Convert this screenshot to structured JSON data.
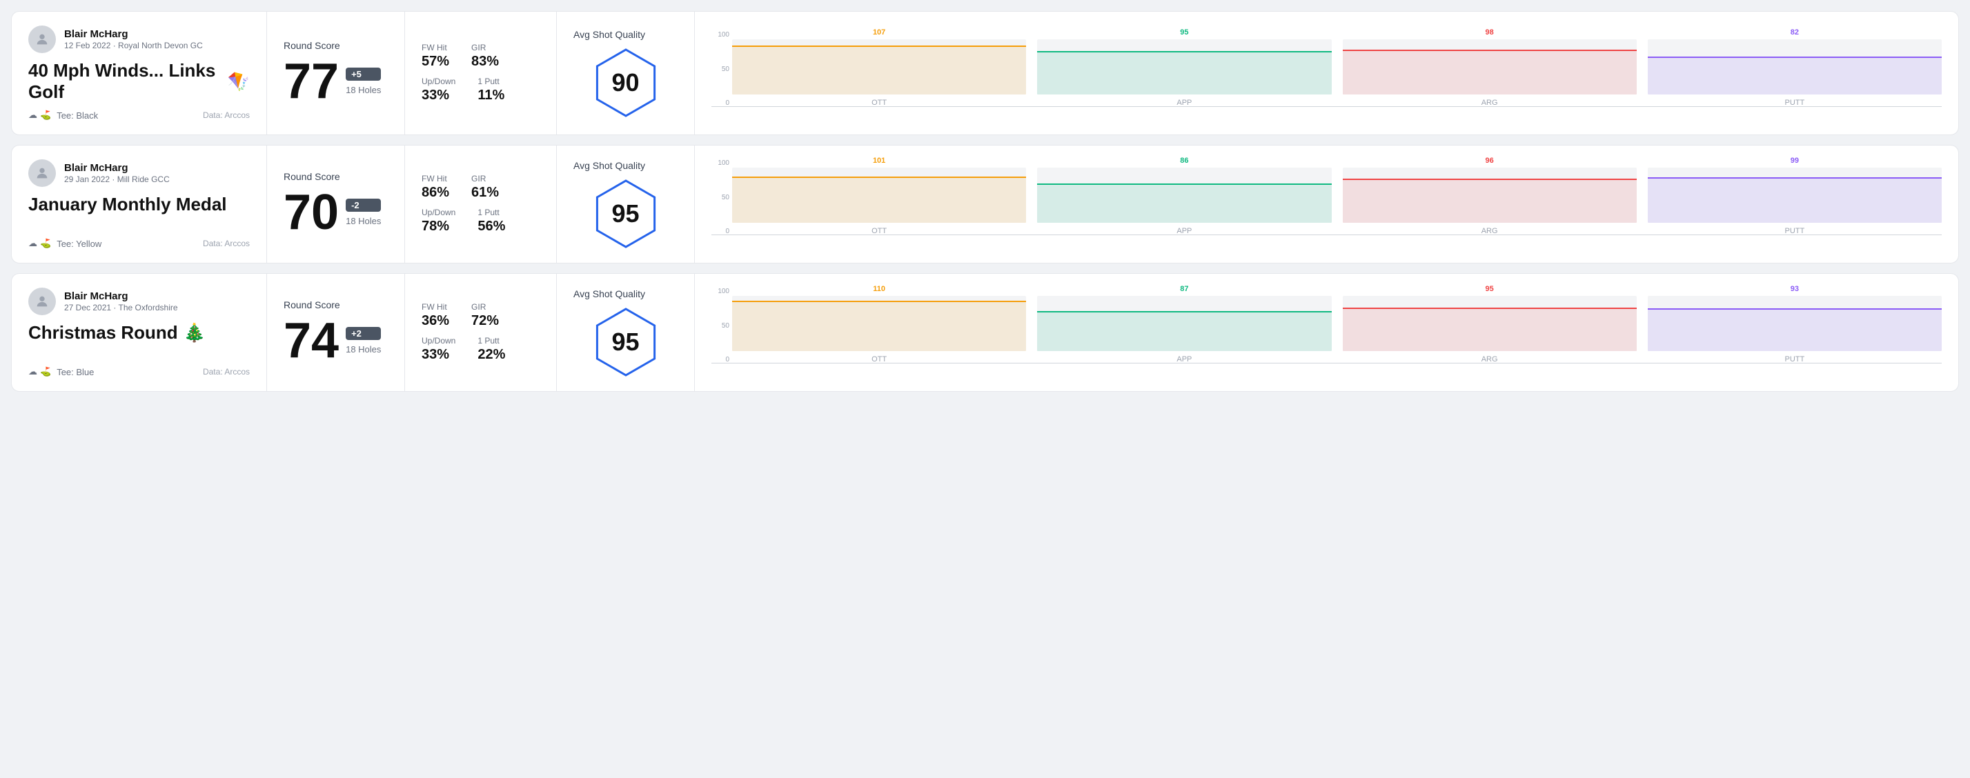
{
  "rounds": [
    {
      "id": "round-1",
      "user": {
        "name": "Blair McHarg",
        "meta": "12 Feb 2022 · Royal North Devon GC"
      },
      "title": "40 Mph Winds... Links Golf",
      "title_emoji": "🪁",
      "tee": "Black",
      "data_source": "Data: Arccos",
      "score": {
        "label": "Round Score",
        "number": "77",
        "modifier": "+5",
        "holes": "18 Holes"
      },
      "stats": {
        "fw_hit_label": "FW Hit",
        "fw_hit_value": "57%",
        "gir_label": "GIR",
        "gir_value": "83%",
        "updown_label": "Up/Down",
        "updown_value": "33%",
        "one_putt_label": "1 Putt",
        "one_putt_value": "11%"
      },
      "quality": {
        "label": "Avg Shot Quality",
        "score": "90"
      },
      "chart": {
        "bars": [
          {
            "label": "OTT",
            "value": 107,
            "color": "#f59e0b",
            "max": 120
          },
          {
            "label": "APP",
            "value": 95,
            "color": "#10b981",
            "max": 120
          },
          {
            "label": "ARG",
            "value": 98,
            "color": "#ef4444",
            "max": 120
          },
          {
            "label": "PUTT",
            "value": 82,
            "color": "#8b5cf6",
            "max": 120
          }
        ],
        "y_labels": [
          "100",
          "50",
          "0"
        ]
      }
    },
    {
      "id": "round-2",
      "user": {
        "name": "Blair McHarg",
        "meta": "29 Jan 2022 · Mill Ride GCC"
      },
      "title": "January Monthly Medal",
      "title_emoji": "",
      "tee": "Yellow",
      "data_source": "Data: Arccos",
      "score": {
        "label": "Round Score",
        "number": "70",
        "modifier": "-2",
        "holes": "18 Holes"
      },
      "stats": {
        "fw_hit_label": "FW Hit",
        "fw_hit_value": "86%",
        "gir_label": "GIR",
        "gir_value": "61%",
        "updown_label": "Up/Down",
        "updown_value": "78%",
        "one_putt_label": "1 Putt",
        "one_putt_value": "56%"
      },
      "quality": {
        "label": "Avg Shot Quality",
        "score": "95"
      },
      "chart": {
        "bars": [
          {
            "label": "OTT",
            "value": 101,
            "color": "#f59e0b",
            "max": 120
          },
          {
            "label": "APP",
            "value": 86,
            "color": "#10b981",
            "max": 120
          },
          {
            "label": "ARG",
            "value": 96,
            "color": "#ef4444",
            "max": 120
          },
          {
            "label": "PUTT",
            "value": 99,
            "color": "#8b5cf6",
            "max": 120
          }
        ],
        "y_labels": [
          "100",
          "50",
          "0"
        ]
      }
    },
    {
      "id": "round-3",
      "user": {
        "name": "Blair McHarg",
        "meta": "27 Dec 2021 · The Oxfordshire"
      },
      "title": "Christmas Round",
      "title_emoji": "🎄",
      "tee": "Blue",
      "data_source": "Data: Arccos",
      "score": {
        "label": "Round Score",
        "number": "74",
        "modifier": "+2",
        "holes": "18 Holes"
      },
      "stats": {
        "fw_hit_label": "FW Hit",
        "fw_hit_value": "36%",
        "gir_label": "GIR",
        "gir_value": "72%",
        "updown_label": "Up/Down",
        "updown_value": "33%",
        "one_putt_label": "1 Putt",
        "one_putt_value": "22%"
      },
      "quality": {
        "label": "Avg Shot Quality",
        "score": "95"
      },
      "chart": {
        "bars": [
          {
            "label": "OTT",
            "value": 110,
            "color": "#f59e0b",
            "max": 120
          },
          {
            "label": "APP",
            "value": 87,
            "color": "#10b981",
            "max": 120
          },
          {
            "label": "ARG",
            "value": 95,
            "color": "#ef4444",
            "max": 120
          },
          {
            "label": "PUTT",
            "value": 93,
            "color": "#8b5cf6",
            "max": 120
          }
        ],
        "y_labels": [
          "100",
          "50",
          "0"
        ]
      }
    }
  ]
}
